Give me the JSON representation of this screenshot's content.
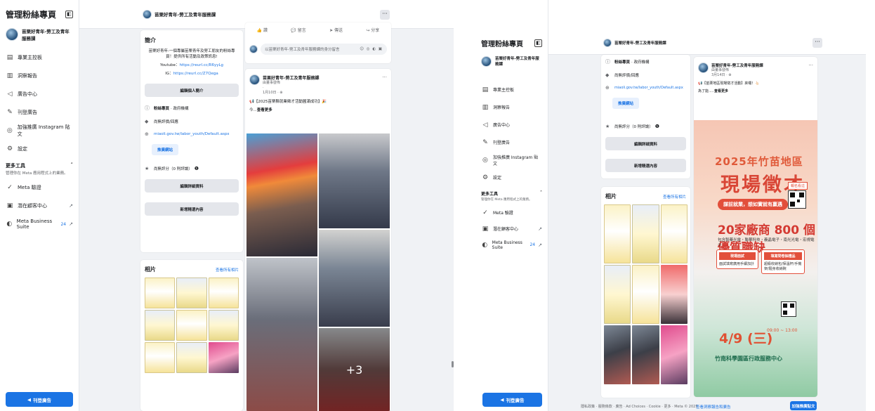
{
  "sidebar": {
    "title": "管理粉絲專頁",
    "page_name": "苗栗好青年-勞工及青年服務課",
    "items": [
      {
        "label": "專業主控板",
        "icon": "dashboard-icon"
      },
      {
        "label": "洞察報告",
        "icon": "insights-icon"
      },
      {
        "label": "廣告中心",
        "icon": "megaphone-icon"
      },
      {
        "label": "刊登廣告",
        "icon": "edit-icon"
      },
      {
        "label": "加強推廣 Instagram 貼文",
        "icon": "instagram-icon"
      },
      {
        "label": "設定",
        "icon": "gear-icon"
      }
    ],
    "more_tools": {
      "title": "更多工具",
      "subtitle": "管理你在 Meta 應用程式上的業務。"
    },
    "tools": [
      {
        "label": "Meta 驗證",
        "icon": "verified-icon"
      },
      {
        "label": "潛在顧客中心",
        "icon": "leads-icon"
      },
      {
        "label": "Meta Business Suite",
        "icon": "meta-icon",
        "badge": "24"
      }
    ],
    "promote_label": "刊登廣告"
  },
  "topbar": {
    "page_name": "苗栗好青年-勞工及青年服務課",
    "more": "···"
  },
  "intro": {
    "title": "簡介",
    "text": "苗栗好青年-一個專屬苗栗青年及勞工朋友的粉絲專頁！提供所有活動及政策訊息!",
    "youtube_label": "Youtube：",
    "youtube_url": "https://reurl.cc/R6yyLg",
    "ig_label": "IG：",
    "ig_url": "https://reurl.cc/Z7Qega",
    "edit_intro": "編輯個人簡介",
    "category_label": "粉絲專頁",
    "category_value": "· 政府機構",
    "no_reviews": "尚無評價/回應",
    "website": "miaoli.gov.tw/labor_youth/Default.aspx",
    "promote_site": "推廣網站",
    "rating": "尚無評分（0 則評論）",
    "edit_details": "編輯詳細資料",
    "add_featured": "新增精選內容"
  },
  "photos": {
    "title": "相片",
    "see_all": "查看所有相片"
  },
  "composer": {
    "actions": [
      "讚",
      "留言",
      "傳送",
      "分享"
    ],
    "placeholder": "以苗栗好青年-勞工及青年服務課的身分留言",
    "emoji": "☺ ◎ ◐ ▣"
  },
  "post_left": {
    "author": "苗栗好青年-勞工及青年服務課",
    "sub1": "由董事發佈",
    "sub2": "·",
    "date": "1月10日 · ⊕",
    "text": "📢【2025苗栗縣就業徵才活動圓滿成功】🎉",
    "more_prefix": "今...",
    "more": "查看更多",
    "plus": "+3"
  },
  "post_right": {
    "author": "苗栗好青年-勞工及青年服務課",
    "sub1": "由董事發佈",
    "date": "3月14日 · ⊕",
    "text": "📢【苗栗地區現場徵才活動】來囉！👆🏻",
    "more_prefix": "為了能.....",
    "more": "查看更多",
    "dots": "···"
  },
  "poster": {
    "title1": "2025年竹苗地區",
    "title2": "現場徵才",
    "ribbon": "謀前就業，想如實就有贏遇",
    "big": "20家廠商 800 個優質職缺",
    "sub": "包含製藥光電・聯華科技・義晶電子・南光光電・宏視電子",
    "box1_title": "現場面試",
    "box1_text": "面試填寫廣用手續加計",
    "box2_title": "填寫問卷抽禮品",
    "box2_text": "超級收納包/保溫杯/手機架/隨身收納碗",
    "date": "4/9 (三)",
    "time": "09:00 ~ 13:00",
    "venue": "竹南科學園區行政服務中心",
    "tag": "報名看這"
  },
  "footer": {
    "legal": "隱私政策 · 服務條款 · 廣告 · Ad Choices · Cookie · 更多 · Meta © 2025",
    "see_insights": "查看洞察報告和廣告",
    "boost": "加強推廣貼文"
  }
}
